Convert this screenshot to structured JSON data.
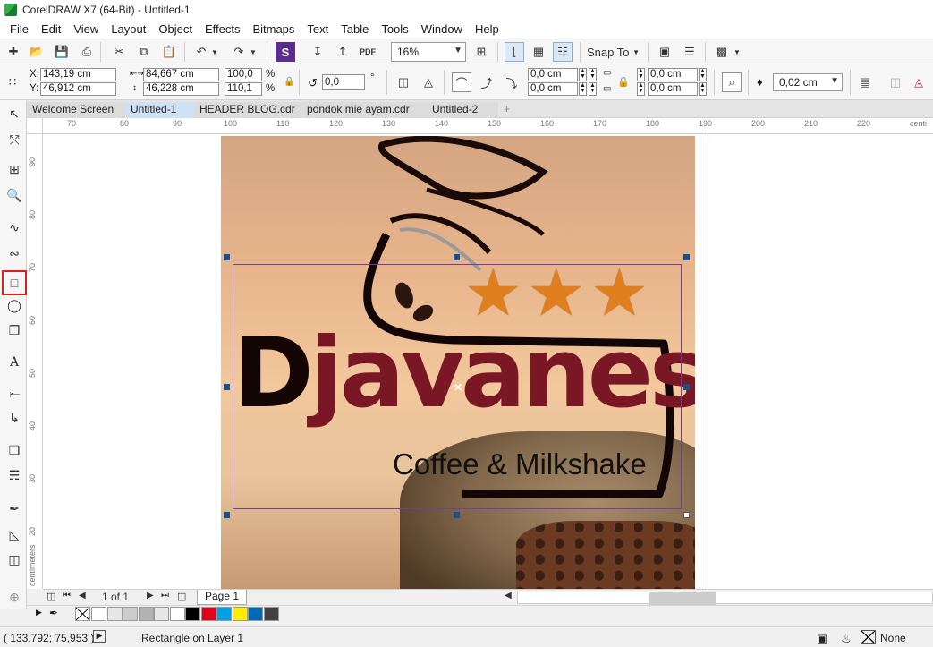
{
  "window": {
    "title": "CorelDRAW X7 (64-Bit) - Untitled-1"
  },
  "menu": [
    "File",
    "Edit",
    "View",
    "Layout",
    "Object",
    "Effects",
    "Bitmaps",
    "Text",
    "Table",
    "Tools",
    "Window",
    "Help"
  ],
  "toolbar": {
    "zoom": "16%",
    "snap_to": "Snap To"
  },
  "props": {
    "x_label": "X:",
    "x": "143,19 cm",
    "y_label": "Y:",
    "y": "46,912 cm",
    "w": "84,667 cm",
    "h": "46,228 cm",
    "scale_w": "100,0",
    "scale_h": "110,1",
    "pct": "%",
    "angle": "0,0",
    "deg": "°",
    "corner1": "0,0 cm",
    "corner2": "0,0 cm",
    "corner3": "0,0 cm",
    "corner4": "0,0 cm",
    "outline": "0,02 cm"
  },
  "tabs": [
    "Welcome Screen",
    "Untitled-1",
    "HEADER BLOG.cdr",
    "pondok mie ayam.cdr",
    "Untitled-2",
    "+"
  ],
  "ruler": {
    "h": [
      "70",
      "80",
      "90",
      "100",
      "110",
      "120",
      "130",
      "140",
      "150",
      "160",
      "170",
      "180",
      "190",
      "200",
      "210",
      "220",
      "centi"
    ],
    "v": [
      "90",
      "80",
      "70",
      "60",
      "50",
      "40",
      "30",
      "20"
    ],
    "unit": "centimeters"
  },
  "artwork": {
    "brand_first": "D",
    "brand_rest": "javanese",
    "subtitle": "Coffee & Milkshake",
    "stars": "★★★"
  },
  "pagenav": {
    "count": "1 of 1",
    "page_tab": "Page 1"
  },
  "palette": [
    "#ffffff",
    "#e6e6e6",
    "#cccccc",
    "#b3b3b3",
    "#e6e6e6",
    "#ffffff",
    "#000000",
    "#e2001a",
    "#009fe3",
    "#ffed00",
    "#0069b4",
    "#404040"
  ],
  "status": {
    "coords": "( 133,792; 75,953 )",
    "info": "Rectangle on Layer 1",
    "fill": "None"
  }
}
